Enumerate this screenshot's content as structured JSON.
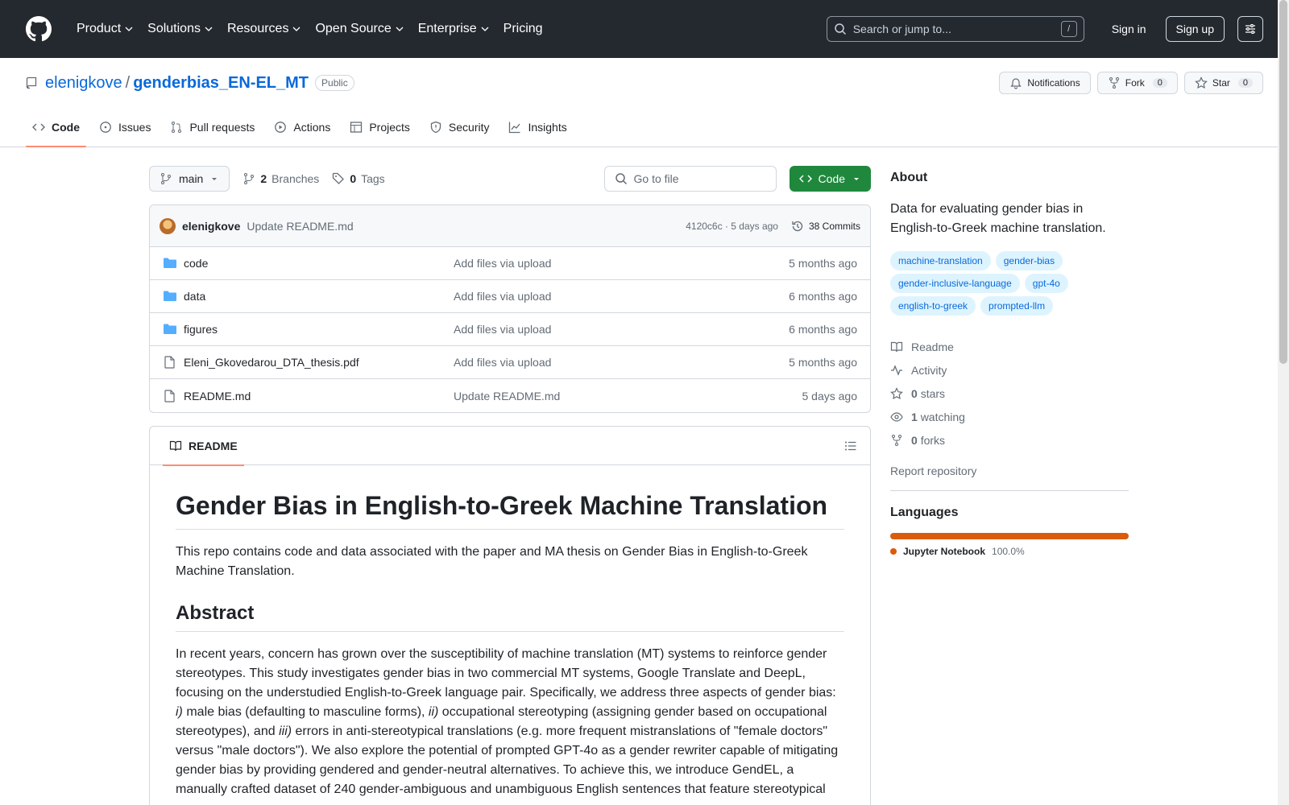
{
  "topnav": {
    "items": [
      {
        "label": "Product",
        "dropdown": true
      },
      {
        "label": "Solutions",
        "dropdown": true
      },
      {
        "label": "Resources",
        "dropdown": true
      },
      {
        "label": "Open Source",
        "dropdown": true
      },
      {
        "label": "Enterprise",
        "dropdown": true
      },
      {
        "label": "Pricing",
        "dropdown": false
      }
    ],
    "search_placeholder": "Search or jump to...",
    "search_shortcut": "/",
    "signin": "Sign in",
    "signup": "Sign up"
  },
  "repo": {
    "owner": "elenigkove",
    "separator": "/",
    "name": "genderbias_EN-EL_MT",
    "visibility": "Public",
    "notifications_label": "Notifications",
    "fork_label": "Fork",
    "fork_count": "0",
    "star_label": "Star",
    "star_count": "0"
  },
  "tabs": [
    {
      "label": "Code",
      "icon": "code-icon",
      "active": true
    },
    {
      "label": "Issues",
      "icon": "issue-icon",
      "active": false
    },
    {
      "label": "Pull requests",
      "icon": "pull-request-icon",
      "active": false
    },
    {
      "label": "Actions",
      "icon": "play-icon",
      "active": false
    },
    {
      "label": "Projects",
      "icon": "table-icon",
      "active": false
    },
    {
      "label": "Security",
      "icon": "shield-icon",
      "active": false
    },
    {
      "label": "Insights",
      "icon": "graph-icon",
      "active": false
    }
  ],
  "filenav": {
    "branch": "main",
    "branches_count": "2",
    "branches_label": "Branches",
    "tags_count": "0",
    "tags_label": "Tags",
    "goto_placeholder": "Go to file",
    "code_button": "Code"
  },
  "commit": {
    "author": "elenigkove",
    "message": "Update README.md",
    "meta": "4120c6c · 5 days ago",
    "commits_label": "38 Commits"
  },
  "files": [
    {
      "name": "code",
      "type": "folder",
      "message": "Add files via upload",
      "age": "5 months ago"
    },
    {
      "name": "data",
      "type": "folder",
      "message": "Add files via upload",
      "age": "6 months ago"
    },
    {
      "name": "figures",
      "type": "folder",
      "message": "Add files via upload",
      "age": "6 months ago"
    },
    {
      "name": "Eleni_Gkovedarou_DTA_thesis.pdf",
      "type": "file",
      "message": "Add files via upload",
      "age": "5 months ago"
    },
    {
      "name": "README.md",
      "type": "file",
      "message": "Update README.md",
      "age": "5 days ago"
    }
  ],
  "readme": {
    "tab_label": "README",
    "title": "Gender Bias in English-to-Greek Machine Translation",
    "intro": "This repo contains code and data associated with the paper and MA thesis on Gender Bias in English-to-Greek Machine Translation.",
    "abstract_heading": "Abstract",
    "abstract_p1": "In recent years, concern has grown over the susceptibility of machine translation (MT) systems to reinforce gender stereotypes. This study investigates gender bias in two commercial MT systems, Google Translate and DeepL, focusing on the understudied English-to-Greek language pair. Specifically, we address three aspects of gender bias: ",
    "abstract_i1": "i)",
    "abstract_p2": " male bias (defaulting to masculine forms), ",
    "abstract_i2": "ii)",
    "abstract_p3": " occupational stereotyping (assigning gender based on occupational stereotypes), and ",
    "abstract_i3": "iii)",
    "abstract_p4": " errors in anti-stereotypical translations (e.g. more frequent mistranslations of \"female doctors\" versus \"male doctors\"). We also explore the potential of prompted GPT-4o as a gender rewriter capable of mitigating gender bias by providing gendered and gender-neutral alternatives. To achieve this, we introduce GendEL, a manually crafted dataset of 240 gender-ambiguous and unambiguous English sentences that feature stereotypical"
  },
  "about": {
    "heading": "About",
    "description": "Data for evaluating gender bias in English-to-Greek machine translation.",
    "topics": [
      "machine-translation",
      "gender-bias",
      "gender-inclusive-language",
      "gpt-4o",
      "english-to-greek",
      "prompted-llm"
    ],
    "readme_link": "Readme",
    "activity_link": "Activity",
    "stars_count": "0",
    "stars_label": "stars",
    "watching_count": "1",
    "watching_label": "watching",
    "forks_count": "0",
    "forks_label": "forks",
    "report": "Report repository"
  },
  "languages": {
    "heading": "Languages",
    "items": [
      {
        "name": "Jupyter Notebook",
        "percent": "100.0%",
        "color": "#DA5B0B"
      }
    ]
  },
  "colors": {
    "header_bg": "#24292f",
    "link": "#0969da",
    "primary_button": "#1f883d",
    "active_tab_underline": "#fd8c73"
  }
}
